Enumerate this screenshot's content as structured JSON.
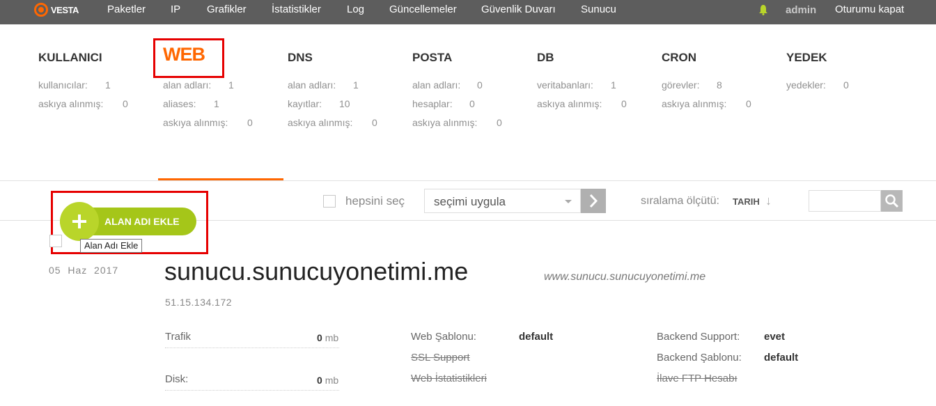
{
  "topbar": {
    "logo": "VESTA",
    "nav": [
      "Paketler",
      "IP",
      "Grafikler",
      "İstatistikler",
      "Log",
      "Güncellemeler",
      "Güvenlik Duvarı",
      "Sunucu"
    ],
    "user": "admin",
    "logout": "Oturumu kapat",
    "accent_color": "#ff6701"
  },
  "stats": [
    {
      "title": "KULLANICI",
      "rows": [
        [
          "kullanıcılar:",
          "1"
        ],
        [
          "askıya alınmış:",
          "0"
        ]
      ]
    },
    {
      "title": "WEB",
      "active": true,
      "rows": [
        [
          "alan adları:",
          "1"
        ],
        [
          "aliases:",
          "1"
        ],
        [
          "askıya alınmış:",
          "0"
        ]
      ]
    },
    {
      "title": "DNS",
      "rows": [
        [
          "alan adları:",
          "1"
        ],
        [
          "kayıtlar:",
          "10"
        ],
        [
          "askıya alınmış:",
          "0"
        ]
      ]
    },
    {
      "title": "POSTA",
      "rows": [
        [
          "alan adları:",
          "0"
        ],
        [
          "hesaplar:",
          "0"
        ],
        [
          "askıya alınmış:",
          "0"
        ]
      ]
    },
    {
      "title": "DB",
      "rows": [
        [
          "veritabanları:",
          "1"
        ],
        [
          "askıya alınmış:",
          "0"
        ]
      ]
    },
    {
      "title": "CRON",
      "rows": [
        [
          "görevler:",
          "8"
        ],
        [
          "askıya alınmış:",
          "0"
        ]
      ]
    },
    {
      "title": "YEDEK",
      "rows": [
        [
          "yedekler:",
          "0"
        ]
      ]
    }
  ],
  "toolbar": {
    "select_all": "hepsini seç",
    "bulk_select": "seçimi uygula",
    "sort_label": "sıralama ölçütü:",
    "sort_value": "TARIH",
    "sort_arrow": "↓"
  },
  "add_button": {
    "label": "ALAN ADI EKLE",
    "tooltip": "Alan Adı Ekle",
    "color": "#a5c619"
  },
  "entry": {
    "date_day": "05",
    "date_month": "Haz",
    "date_year": "2017",
    "domain": "sunucu.sunucuyonetimi.me",
    "alias": "www.sunucu.sunucuyonetimi.me",
    "ip": "51.15.134.172",
    "traffic_label": "Trafik",
    "traffic_value": "0",
    "traffic_unit": "mb",
    "disk_label": "Disk:",
    "disk_value": "0",
    "disk_unit": "mb",
    "web_template_label": "Web Şablonu:",
    "web_template_value": "default",
    "ssl_label": "SSL Support",
    "web_stats_label": "Web İstatistikleri",
    "backend_support_label": "Backend Support:",
    "backend_support_value": "evet",
    "backend_template_label": "Backend Şablonu:",
    "backend_template_value": "default",
    "ftp_label": "İlave FTP Hesabı"
  }
}
